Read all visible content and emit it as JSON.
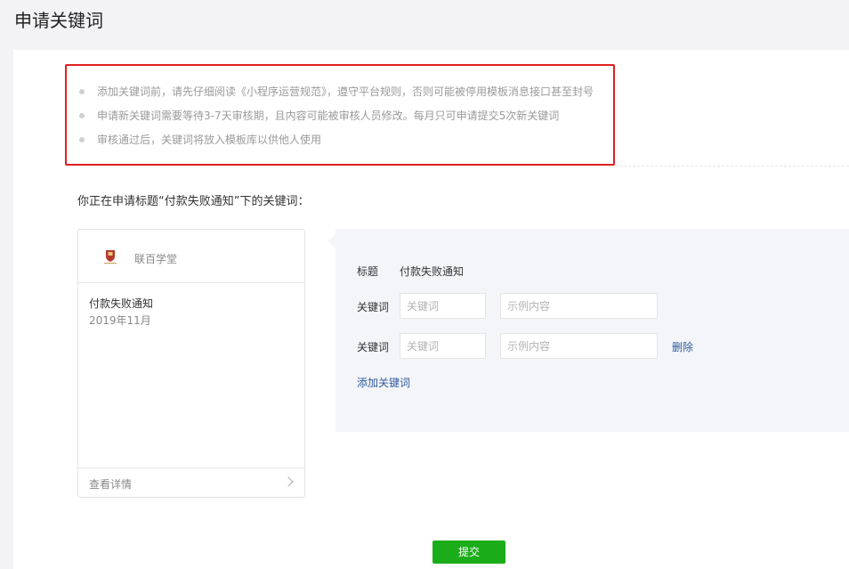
{
  "page": {
    "title": "申请关键词"
  },
  "notices": [
    "添加关键词前，请先仔细阅读《小程序运营规范》，遵守平台规则，否则可能被停用模板消息接口甚至封号",
    "申请新关键词需要等待3-7天审核期，且内容可能被审核人员修改。每月只可申请提交5次新关键词",
    "审核通过后，关键词将放入模板库以供他人使用"
  ],
  "intro": "你正在申请标题“付款失败通知”下的关键词：",
  "preview": {
    "account_name": "联百学堂",
    "title": "付款失败通知",
    "date": "2019年11月",
    "detail_link": "查看详情"
  },
  "form": {
    "title_label": "标题",
    "title_value": "付款失败通知",
    "keyword_label": "关键词",
    "keyword_placeholder": "关键词",
    "example_placeholder": "示例内容",
    "delete_label": "删除",
    "add_keyword_label": "添加关键词"
  },
  "submit_label": "提交",
  "colors": {
    "accent_green": "#1aad19",
    "link_blue": "#2e5b9b",
    "highlight_red": "#e02020"
  },
  "icons": {
    "logo": "school-logo-icon",
    "detail_arrow": "chevron-right-icon"
  }
}
